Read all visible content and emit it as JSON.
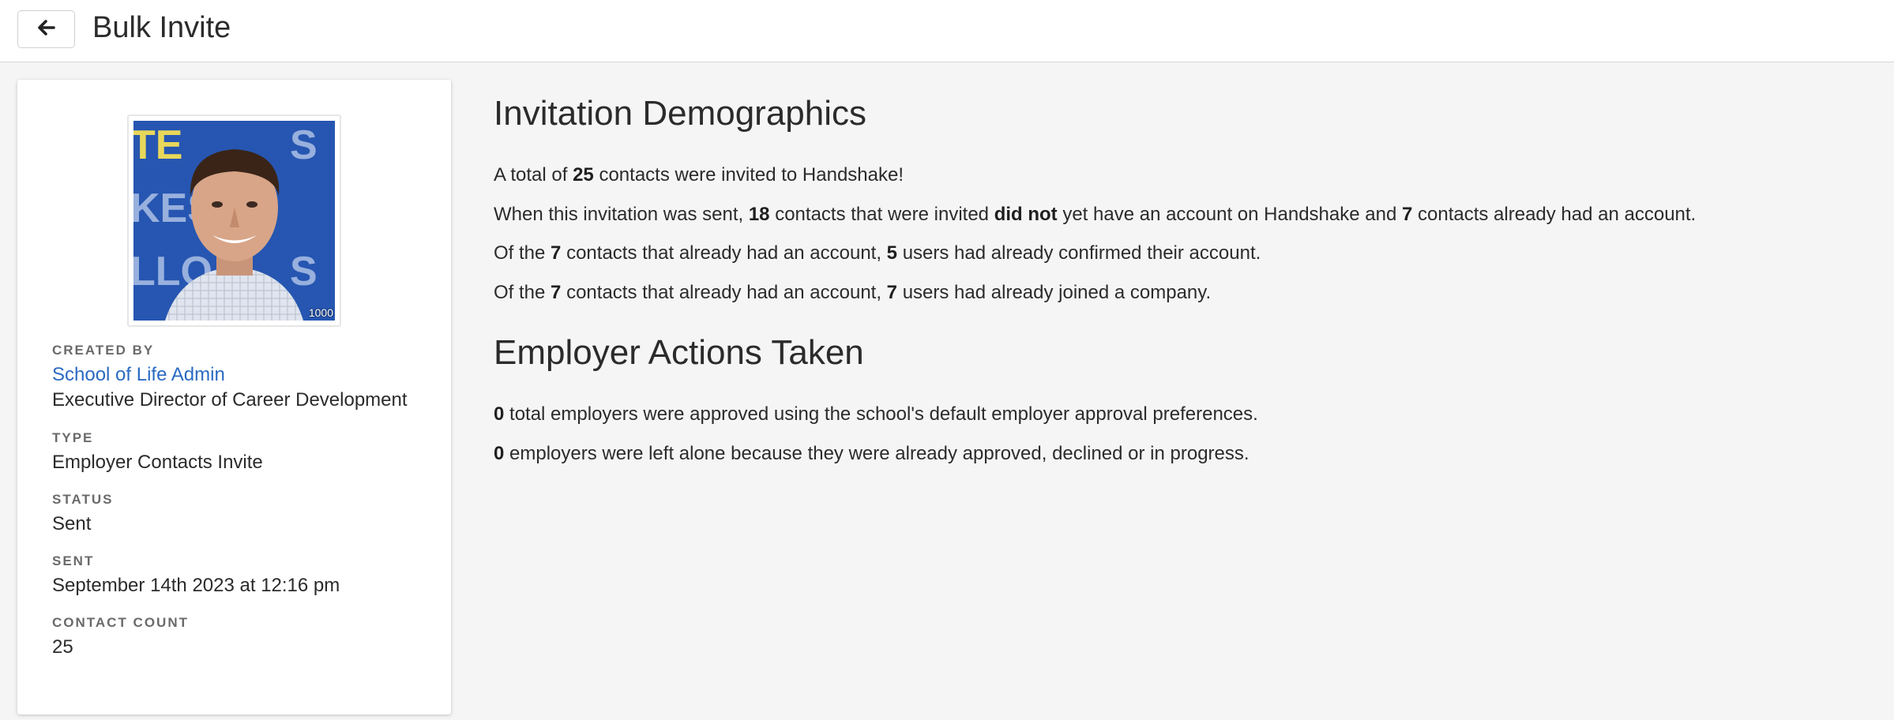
{
  "header": {
    "title": "Bulk Invite",
    "back_icon": "arrow-left-icon"
  },
  "profile": {
    "avatar_badge": "1000",
    "created_by_label": "CREATED BY",
    "created_by_name": "School of Life Admin",
    "created_by_title": "Executive Director of Career Development",
    "type_label": "TYPE",
    "type_value": "Employer Contacts Invite",
    "status_label": "STATUS",
    "status_value": "Sent",
    "sent_label": "SENT",
    "sent_value": "September 14th 2023 at 12:16 pm",
    "contact_count_label": "CONTACT COUNT",
    "contact_count_value": "25"
  },
  "demographics": {
    "title": "Invitation Demographics",
    "line1": {
      "a": "A total of ",
      "b1": "25",
      "c": " contacts were invited to Handshake!"
    },
    "line2": {
      "a": "When this invitation was sent, ",
      "b1": "18",
      "c": " contacts that were invited ",
      "b2": "did not",
      "d": " yet have an account on Handshake and ",
      "b3": "7",
      "e": " contacts already had an account."
    },
    "line3": {
      "a": "Of the ",
      "b1": "7",
      "c": " contacts that already had an account, ",
      "b2": "5",
      "d": " users had already confirmed their account."
    },
    "line4": {
      "a": "Of the ",
      "b1": "7",
      "c": " contacts that already had an account, ",
      "b2": "7",
      "d": " users had already joined a company."
    }
  },
  "employer_actions": {
    "title": "Employer Actions Taken",
    "line1": {
      "b1": "0",
      "a": " total employers were approved using the school's default employer approval preferences."
    },
    "line2": {
      "b1": "0",
      "a": " employers were left alone because they were already approved, declined or in progress."
    }
  },
  "colors": {
    "link": "#2a6ac2",
    "background": "#f5f5f5",
    "card": "#ffffff",
    "text": "#2b2b2b"
  }
}
